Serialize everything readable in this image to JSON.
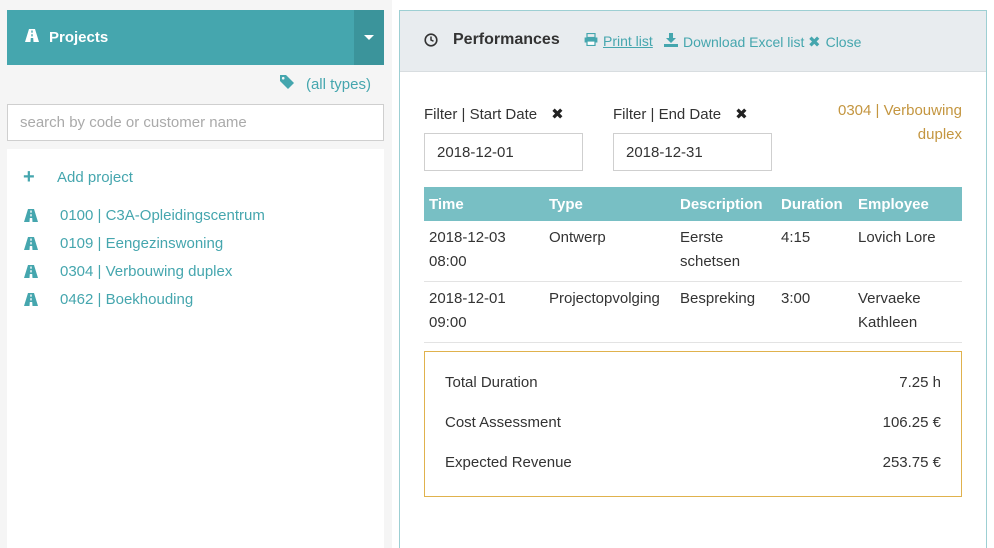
{
  "left": {
    "header_title": "Projects",
    "types_label": "(all types)",
    "search_placeholder": "search by code or customer name",
    "add_label": "Add project",
    "projects": [
      {
        "label": "0100 | C3A-Opleidingscentrum"
      },
      {
        "label": "0109 | Eengezinswoning"
      },
      {
        "label": "0304 | Verbouwing duplex"
      },
      {
        "label": "0462 | Boekhouding"
      }
    ]
  },
  "right": {
    "title": "Performances",
    "print_label": "Print list",
    "download_label": "Download Excel list",
    "close_label": "Close",
    "filter_start_label": "Filter | Start Date",
    "filter_start_value": "2018-12-01",
    "filter_end_label": "Filter | End Date",
    "filter_end_value": "2018-12-31",
    "project_name": "0304 | Verbouwing duplex",
    "table": {
      "headers": [
        "Time",
        "Type",
        "Description",
        "Duration",
        "Employee"
      ],
      "rows": [
        [
          "2018-12-03 08:00",
          "Ontwerp",
          "Eerste schetsen",
          "4:15",
          "Lovich Lore"
        ],
        [
          "2018-12-01 09:00",
          "Projectopvolging",
          "Bespreking",
          "3:00",
          "Vervaeke Kathleen"
        ]
      ]
    },
    "summary": [
      {
        "label": "Total Duration",
        "value": "7.25 h"
      },
      {
        "label": "Cost Assessment",
        "value": "106.25 €"
      },
      {
        "label": "Expected Revenue",
        "value": "253.75 €"
      }
    ]
  },
  "colors": {
    "accent": "#45a6ae",
    "table_header": "#78bfc4",
    "project_name": "#c49640",
    "summary_border": "#e0b24d"
  },
  "icons": {
    "project": "road-icon",
    "tag": "tag-icon",
    "clock": "clock-icon",
    "print": "printer-icon",
    "download": "download-icon",
    "close": "close-icon"
  }
}
